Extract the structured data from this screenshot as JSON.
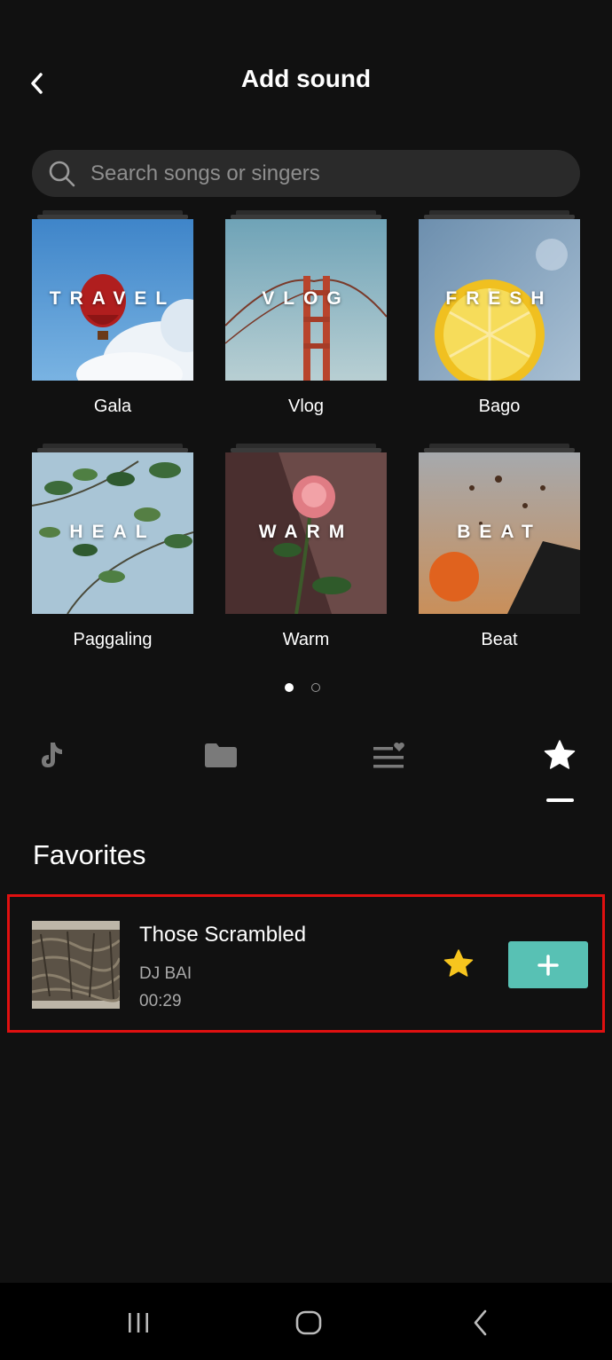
{
  "header": {
    "title": "Add sound",
    "back_icon": "chevron-left-icon"
  },
  "search": {
    "placeholder": "Search songs or singers",
    "icon": "search-icon"
  },
  "categories": [
    {
      "cover_word": "TRAVEL",
      "name": "Gala"
    },
    {
      "cover_word": "VLOG",
      "name": "Vlog"
    },
    {
      "cover_word": "FRESH",
      "name": "Bago"
    },
    {
      "cover_word": "HEAL",
      "name": "Paggaling"
    },
    {
      "cover_word": "WARM",
      "name": "Warm"
    },
    {
      "cover_word": "BEAT",
      "name": "Beat"
    }
  ],
  "pager": {
    "pages": 2,
    "active": 1
  },
  "tabs": [
    {
      "icon": "tiktok-icon",
      "active": false
    },
    {
      "icon": "folder-icon",
      "active": false
    },
    {
      "icon": "playlist-heart-icon",
      "active": false
    },
    {
      "icon": "star-icon",
      "active": true
    }
  ],
  "favorites": {
    "heading": "Favorites",
    "songs": [
      {
        "title": "Those Scrambled",
        "artist": "DJ BAI",
        "duration": "00:29",
        "favorited": true
      }
    ]
  },
  "colors": {
    "background": "#111111",
    "accent": "#58c1b4",
    "star": "#f7c51e",
    "highlight": "#e01010"
  },
  "navbar": {
    "icons": [
      "recent-apps-icon",
      "home-icon",
      "back-icon"
    ]
  }
}
